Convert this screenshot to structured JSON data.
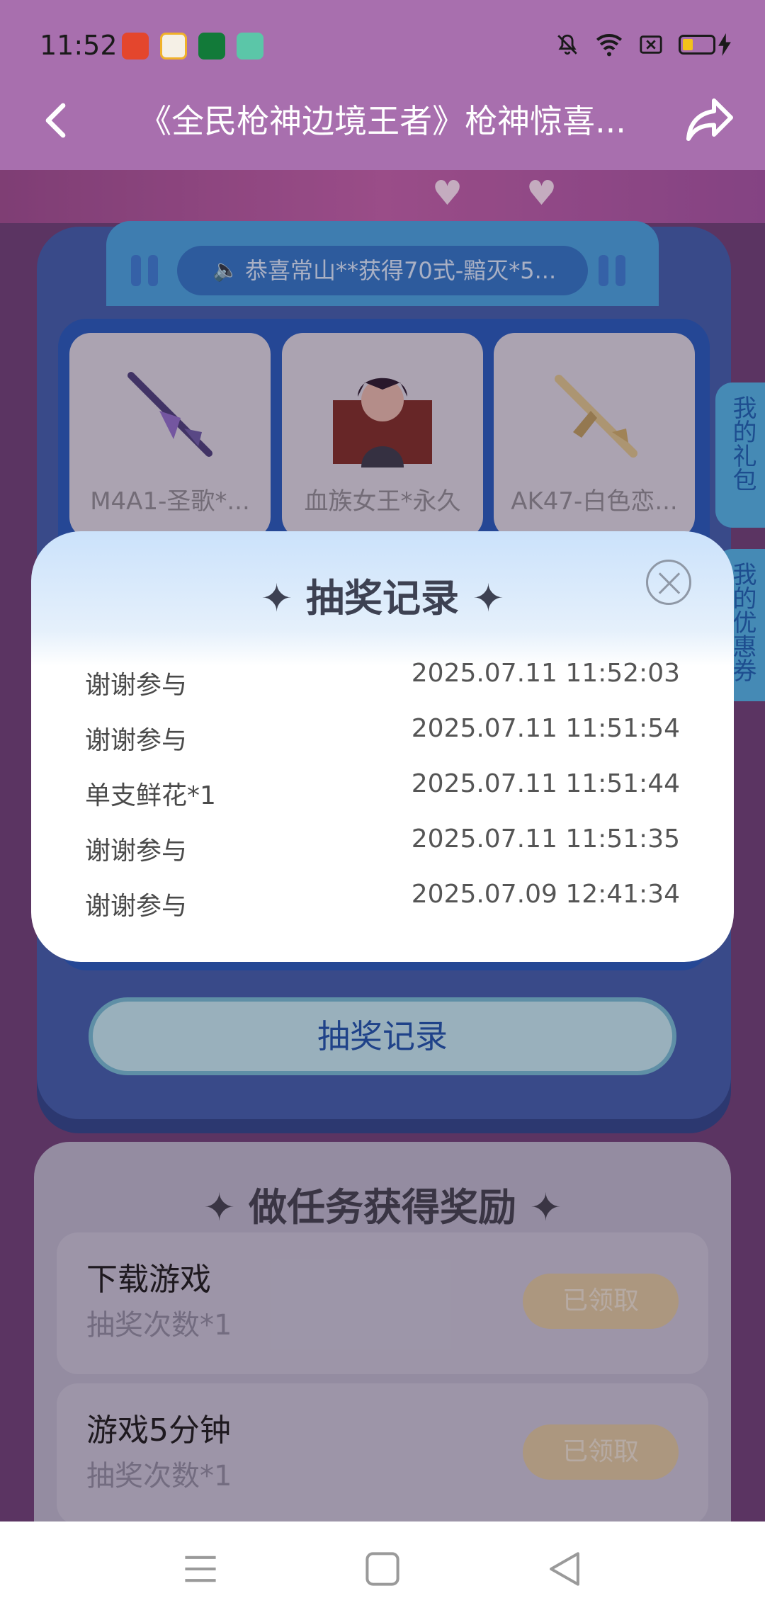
{
  "status_bar": {
    "time": "11:52"
  },
  "header": {
    "title": "《全民枪神边境王者》枪神惊喜..."
  },
  "notice": {
    "text": "恭喜常山**获得70式-黯灭*5..."
  },
  "prizes": [
    {
      "name": "M4A1-圣歌*..."
    },
    {
      "name": "血族女王*永久"
    },
    {
      "name": "AK47-白色恋..."
    }
  ],
  "side_tabs": [
    {
      "label": "我的礼包"
    },
    {
      "label": "我的优惠券"
    }
  ],
  "lottery": {
    "record_button": "抽奖记录"
  },
  "tasks": {
    "title": "做任务获得奖励",
    "items": [
      {
        "name": "下载游戏",
        "reward": "抽奖次数*1",
        "button": "已领取"
      },
      {
        "name": "游戏5分钟",
        "reward": "抽奖次数*1",
        "button": "已领取"
      }
    ]
  },
  "modal": {
    "title": "抽奖记录",
    "records": [
      {
        "prize": "谢谢参与",
        "time": "2025.07.11 11:52:03"
      },
      {
        "prize": "谢谢参与",
        "time": "2025.07.11 11:51:54"
      },
      {
        "prize": "单支鲜花*1",
        "time": "2025.07.11 11:51:44"
      },
      {
        "prize": "谢谢参与",
        "time": "2025.07.11 11:51:35"
      },
      {
        "prize": "谢谢参与",
        "time": "2025.07.09 12:41:34"
      }
    ]
  }
}
